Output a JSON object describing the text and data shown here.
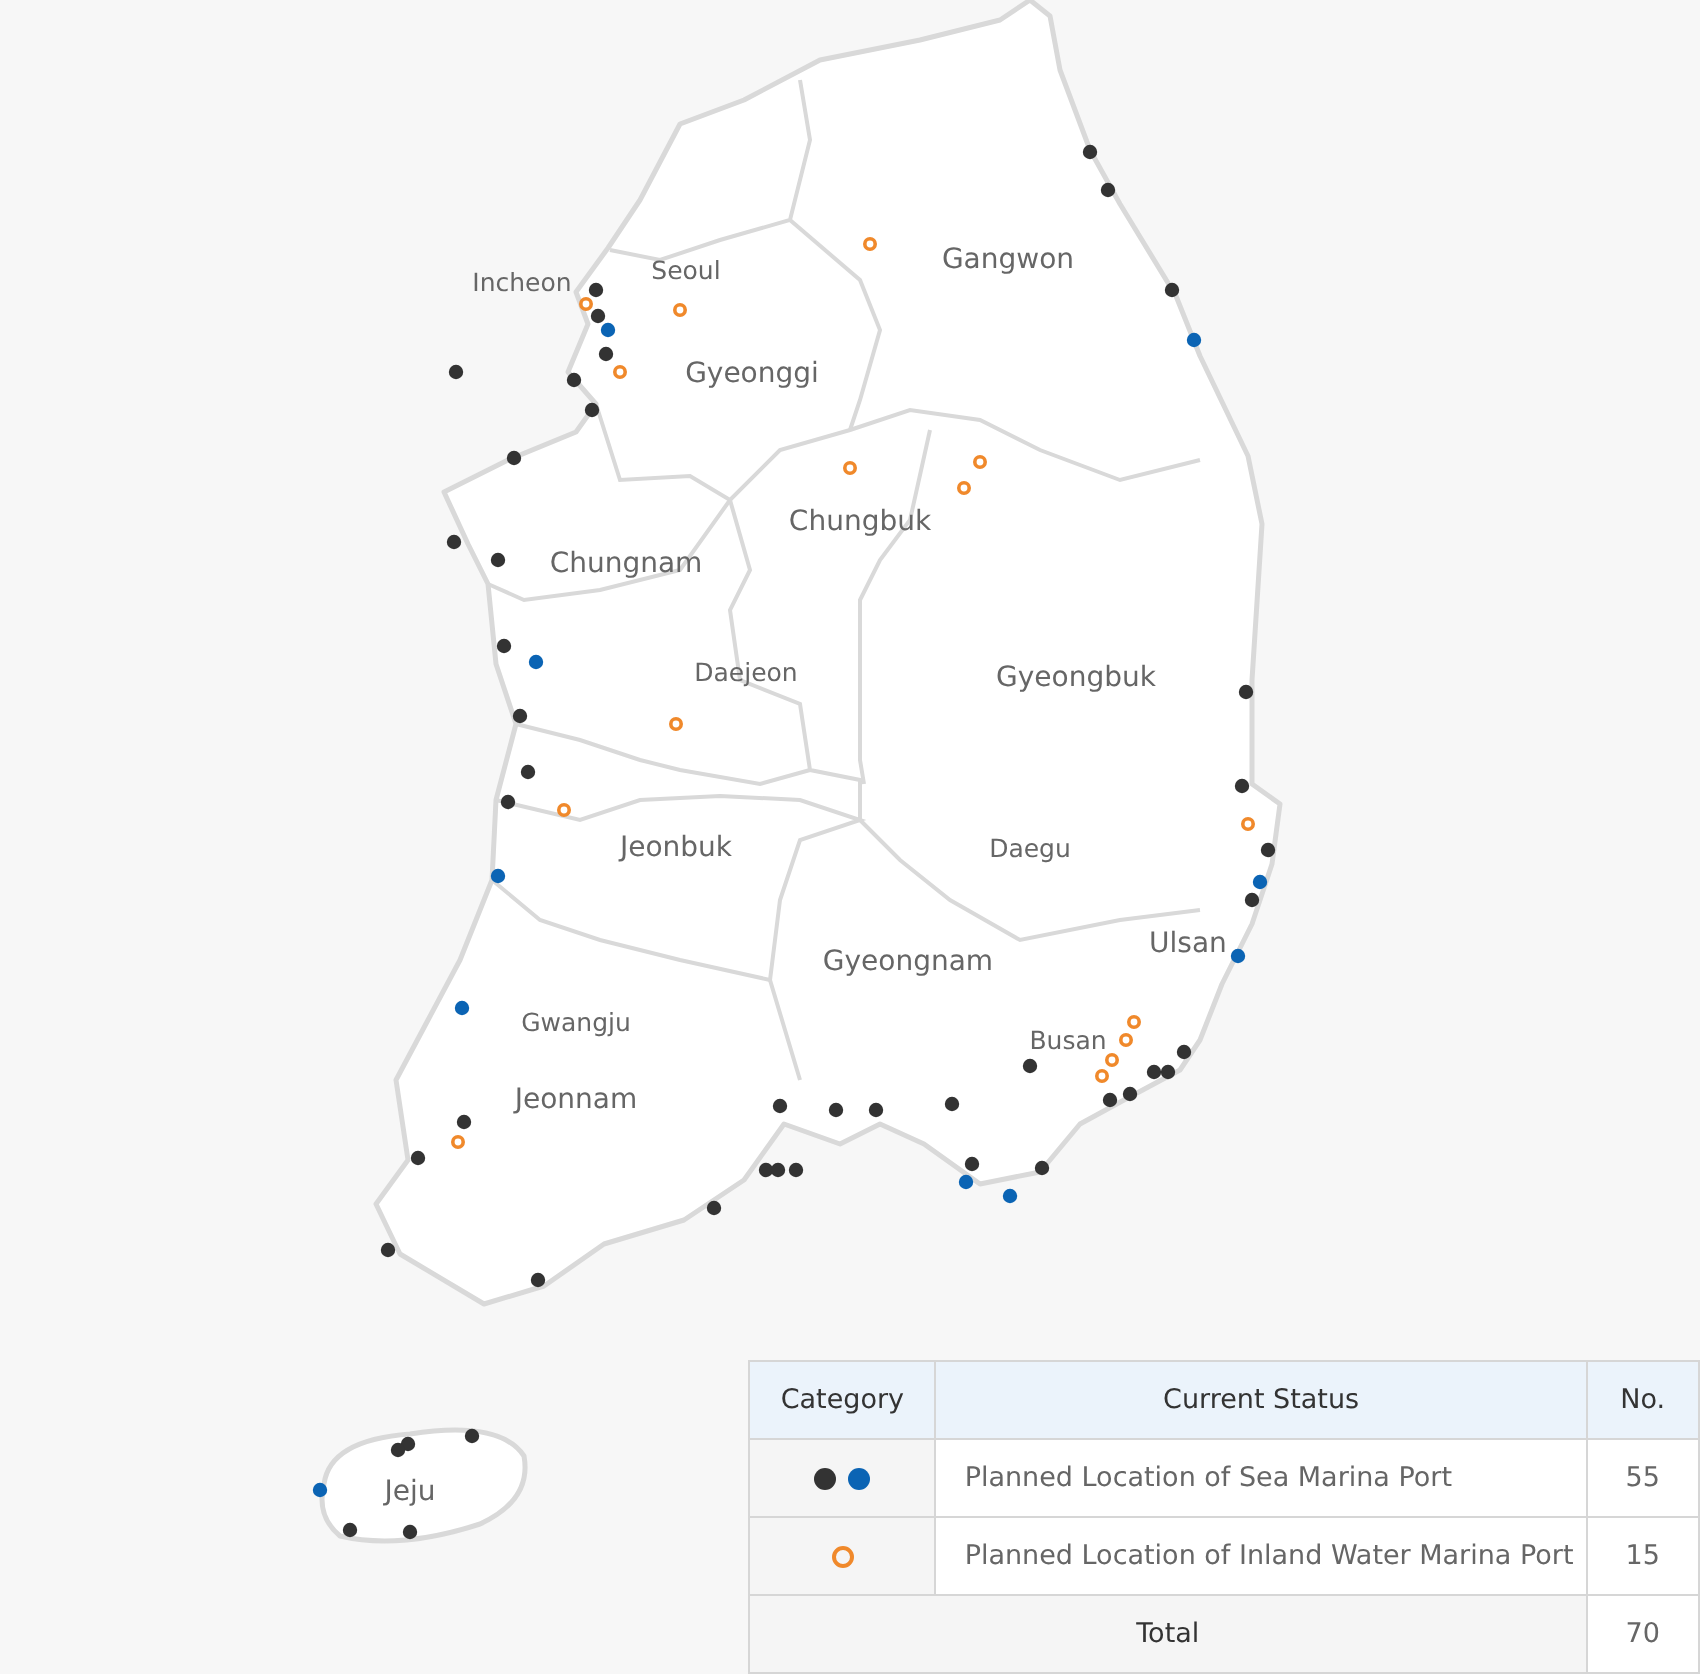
{
  "map": {
    "regions": [
      {
        "name": "Incheon"
      },
      {
        "name": "Seoul"
      },
      {
        "name": "Gangwon"
      },
      {
        "name": "Gyeonggi"
      },
      {
        "name": "Chungbuk"
      },
      {
        "name": "Chungnam"
      },
      {
        "name": "Daejeon"
      },
      {
        "name": "Gyeongbuk"
      },
      {
        "name": "Jeonbuk"
      },
      {
        "name": "Daegu"
      },
      {
        "name": "Ulsan"
      },
      {
        "name": "Gyeongnam"
      },
      {
        "name": "Busan"
      },
      {
        "name": "Gwangju"
      },
      {
        "name": "Jeonnam"
      },
      {
        "name": "Jeju"
      }
    ]
  },
  "table": {
    "columns": [
      "Category",
      "Current Status",
      "No."
    ],
    "rows": [
      {
        "markers": [
          {
            "color": "#333333",
            "filled": true
          },
          {
            "color": "#0b64b4",
            "filled": true
          }
        ],
        "status": "Planned Location of Sea Marina Port",
        "count": "55"
      },
      {
        "markers": [
          {
            "color": "#f0892b",
            "filled": false
          }
        ],
        "status": "Planned Location of Inland Water Marina Port",
        "count": "15"
      }
    ],
    "total": {
      "label": "Total",
      "count": "70"
    }
  }
}
